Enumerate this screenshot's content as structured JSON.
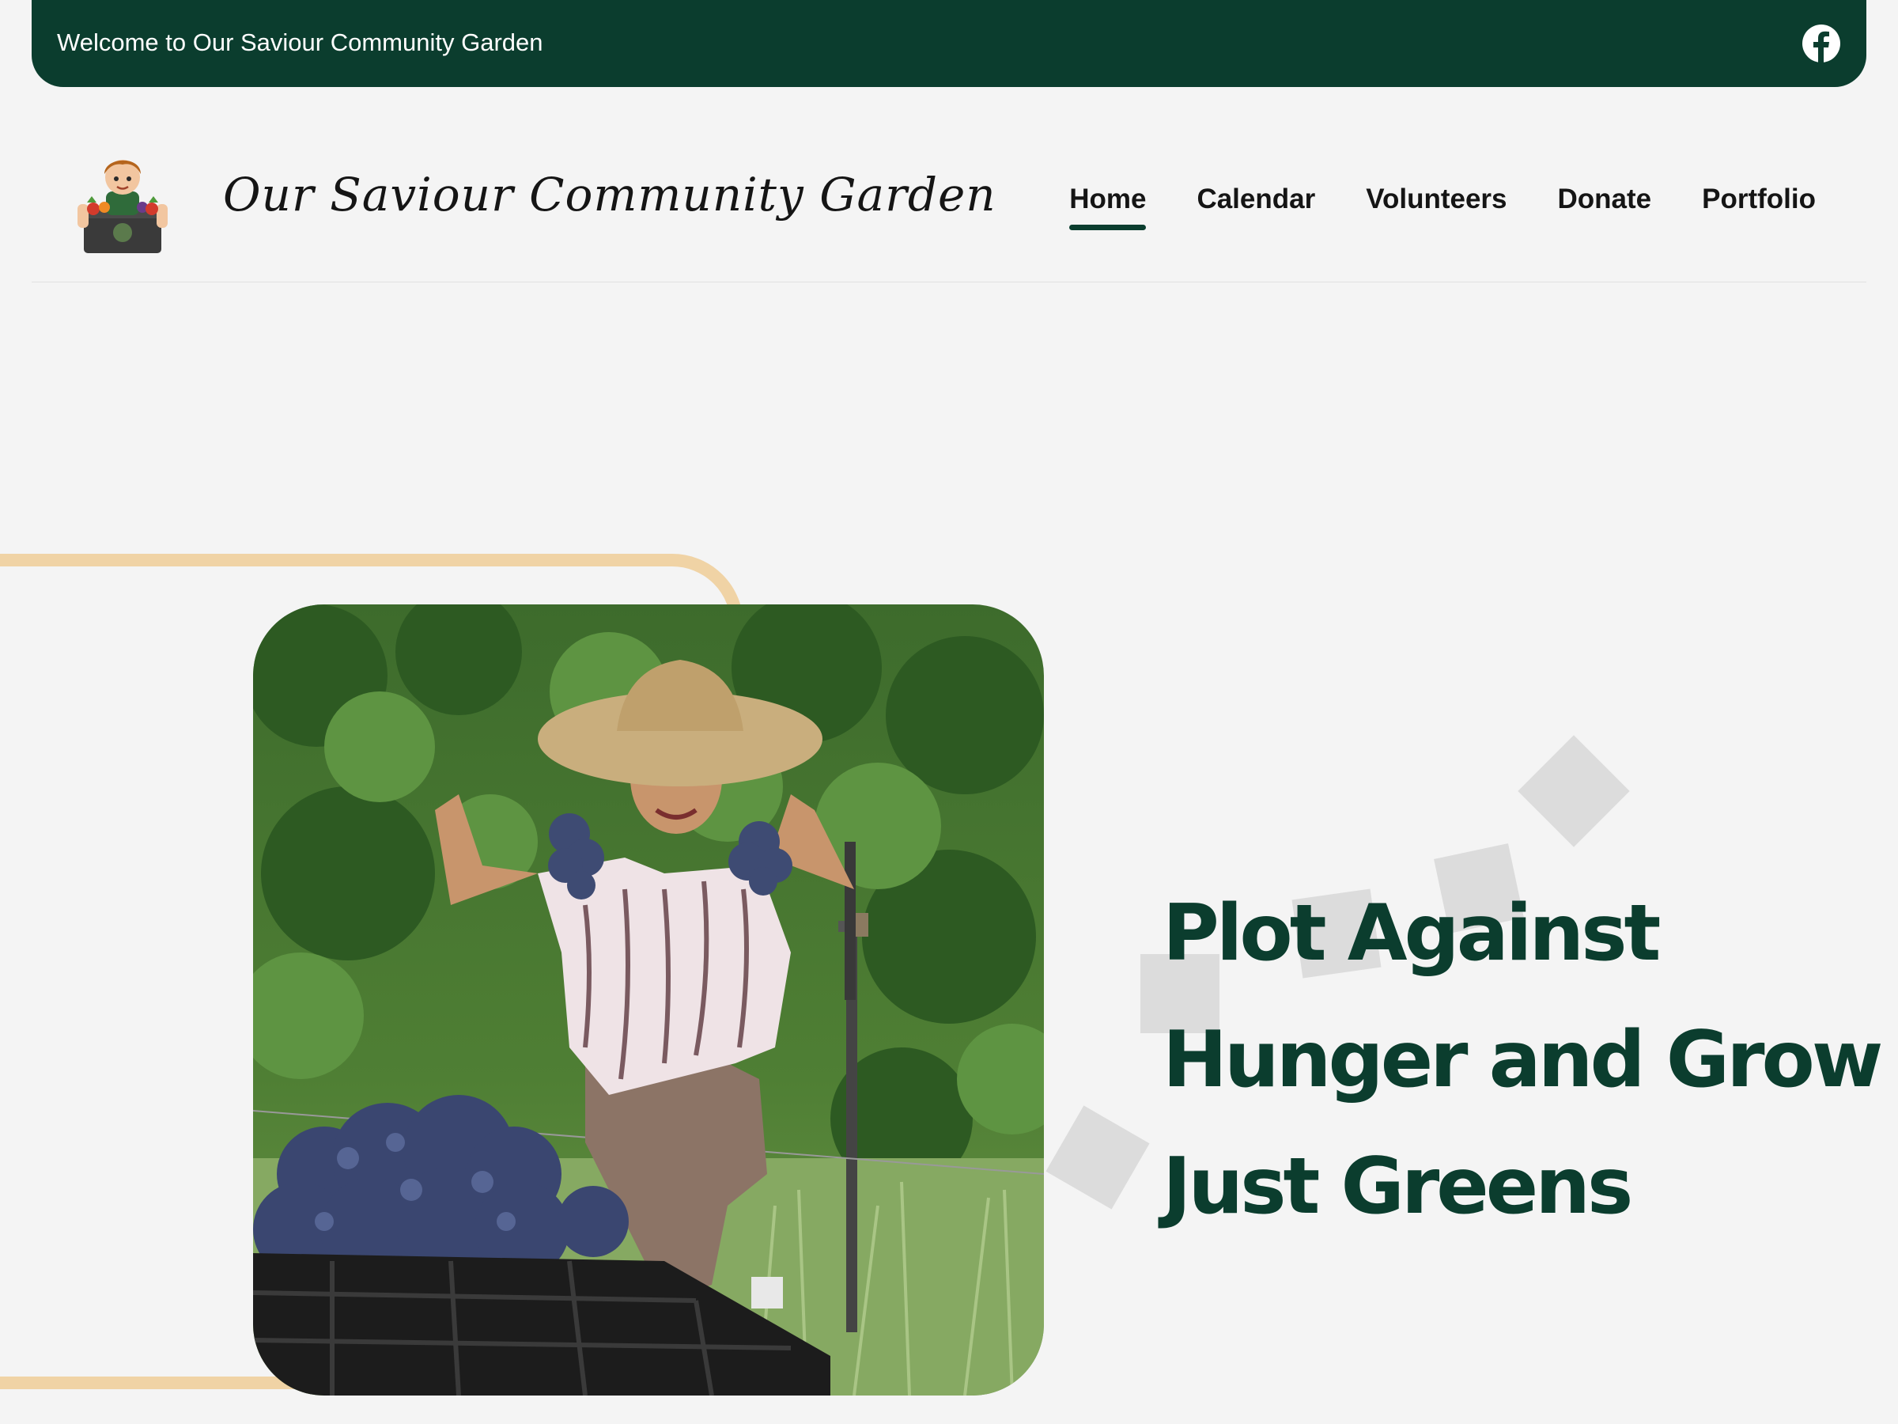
{
  "topbar": {
    "welcome_text": "Welcome to Our Saviour Community Garden",
    "social_icon": "facebook-icon",
    "background_color": "#0b3d2e"
  },
  "header": {
    "site_title": "Our Saviour Community Garden",
    "logo_icon": "child-with-vegetable-crate-logo",
    "nav": [
      {
        "label": "Home",
        "active": true
      },
      {
        "label": "Calendar",
        "active": false
      },
      {
        "label": "Volunteers",
        "active": false
      },
      {
        "label": "Donate",
        "active": false
      },
      {
        "label": "Portfolio",
        "active": false
      }
    ]
  },
  "hero": {
    "headline": "Plot Against Hunger and Grow Just Greens",
    "photo": "gardener-with-grape-harvest-photo",
    "headline_color": "#0b3d2e",
    "frame_color": "#f0d3a5"
  }
}
